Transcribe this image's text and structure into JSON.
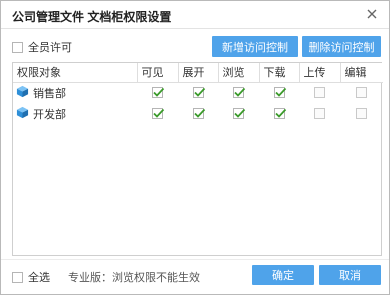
{
  "dialog": {
    "title": "公司管理文件 文档柜权限设置",
    "close_icon": "close-icon"
  },
  "toolbar": {
    "all_members_label": "全员许可",
    "all_members_checked": false,
    "add_access_label": "新增访问控制",
    "remove_access_label": "删除访问控制"
  },
  "table": {
    "headers": [
      "权限对象",
      "可见",
      "展开",
      "浏览",
      "下载",
      "上传",
      "编辑"
    ],
    "rows": [
      {
        "name": "销售部",
        "icon": "department-cube-icon",
        "perms": [
          true,
          true,
          true,
          true,
          false,
          false
        ]
      },
      {
        "name": "开发部",
        "icon": "department-cube-icon",
        "perms": [
          true,
          true,
          true,
          true,
          false,
          false
        ]
      }
    ]
  },
  "footer": {
    "select_all_label": "全选",
    "select_all_checked": false,
    "note": "专业版：浏览权限不能生效",
    "ok_label": "确定",
    "cancel_label": "取消"
  },
  "colors": {
    "button_blue": "#4fa3ea",
    "check_green": "#3a9a2a",
    "cube_blue": "#2e8fd8"
  }
}
